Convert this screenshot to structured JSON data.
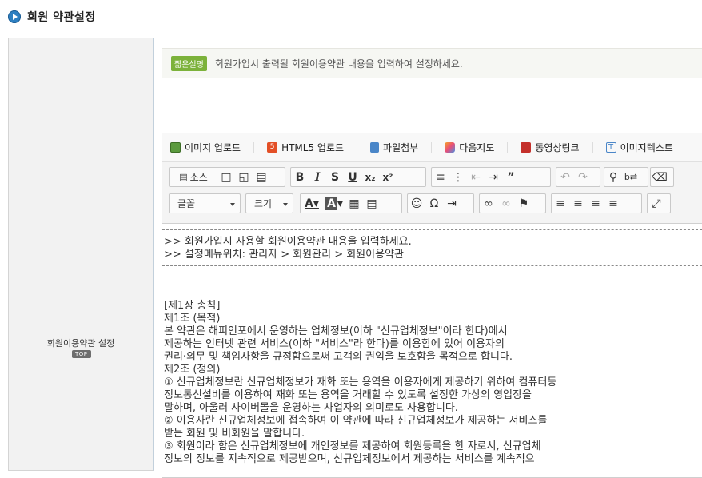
{
  "header": {
    "title": "회원 약관설정"
  },
  "label": {
    "text": "회원이용약관 설정",
    "top_badge": "TOP"
  },
  "desc": {
    "badge": "짧은설명",
    "text": "회원가입시 출력될 회원이용약관 내용을 입력하여 설정하세요."
  },
  "attach_bar": [
    "이미지 업로드",
    "HTML5 업로드",
    "파일첨부",
    "다음지도",
    "동영상링크",
    "이미지텍스트"
  ],
  "toolbar": {
    "source_label": "소스",
    "font_combo": "글꼴",
    "size_combo": "크기"
  },
  "icons": {
    "accent": "#2d7fc1",
    "desc_badge_color": "#7cb23b"
  },
  "content": {
    "lines": [
      ">> 회원가입시 사용할 회원이용약관 내용을 입력하세요.",
      ">> 설정메뉴위치: 관리자 > 회원관리 > 회원이용약관",
      "[제1장   총칙]",
      "제1조 (목적)",
      "본 약관은 해피인포에서 운영하는 업체정보(이하 \"신규업체정보\"이라 한다)에서",
      "제공하는 인터넷 관련 서비스(이하 \"서비스\"라 한다)를 이용함에 있어 이용자의",
      "권리·의무 및 책임사항을 규정함으로써 고객의 권익을 보호함을 목적으로 합니다.",
      "제2조 (정의)",
      "① 신규업체정보란 신규업체정보가 재화 또는 용역을 이용자에게 제공하기 위하여 컴퓨터등",
      "정보통신설비를 이용하여 재화 또는 용역을 거래할 수 있도록 설정한 가상의 영업장을",
      "말하며, 아울러 사이버몰을 운영하는 사업자의 의미로도 사용합니다.",
      "② 이용자란 신규업체정보에 접속하여 이 약관에 따라 신규업체정보가 제공하는 서비스를",
      "받는 회원 및 비회원을 말합니다.",
      "③ 회원이라 함은 신규업체정보에 개인정보를 제공하여 회원등록을 한 자로서, 신규업체",
      "정보의 정보를 지속적으로 제공받으며, 신규업체정보에서 제공하는 서비스를 계속적으"
    ]
  }
}
